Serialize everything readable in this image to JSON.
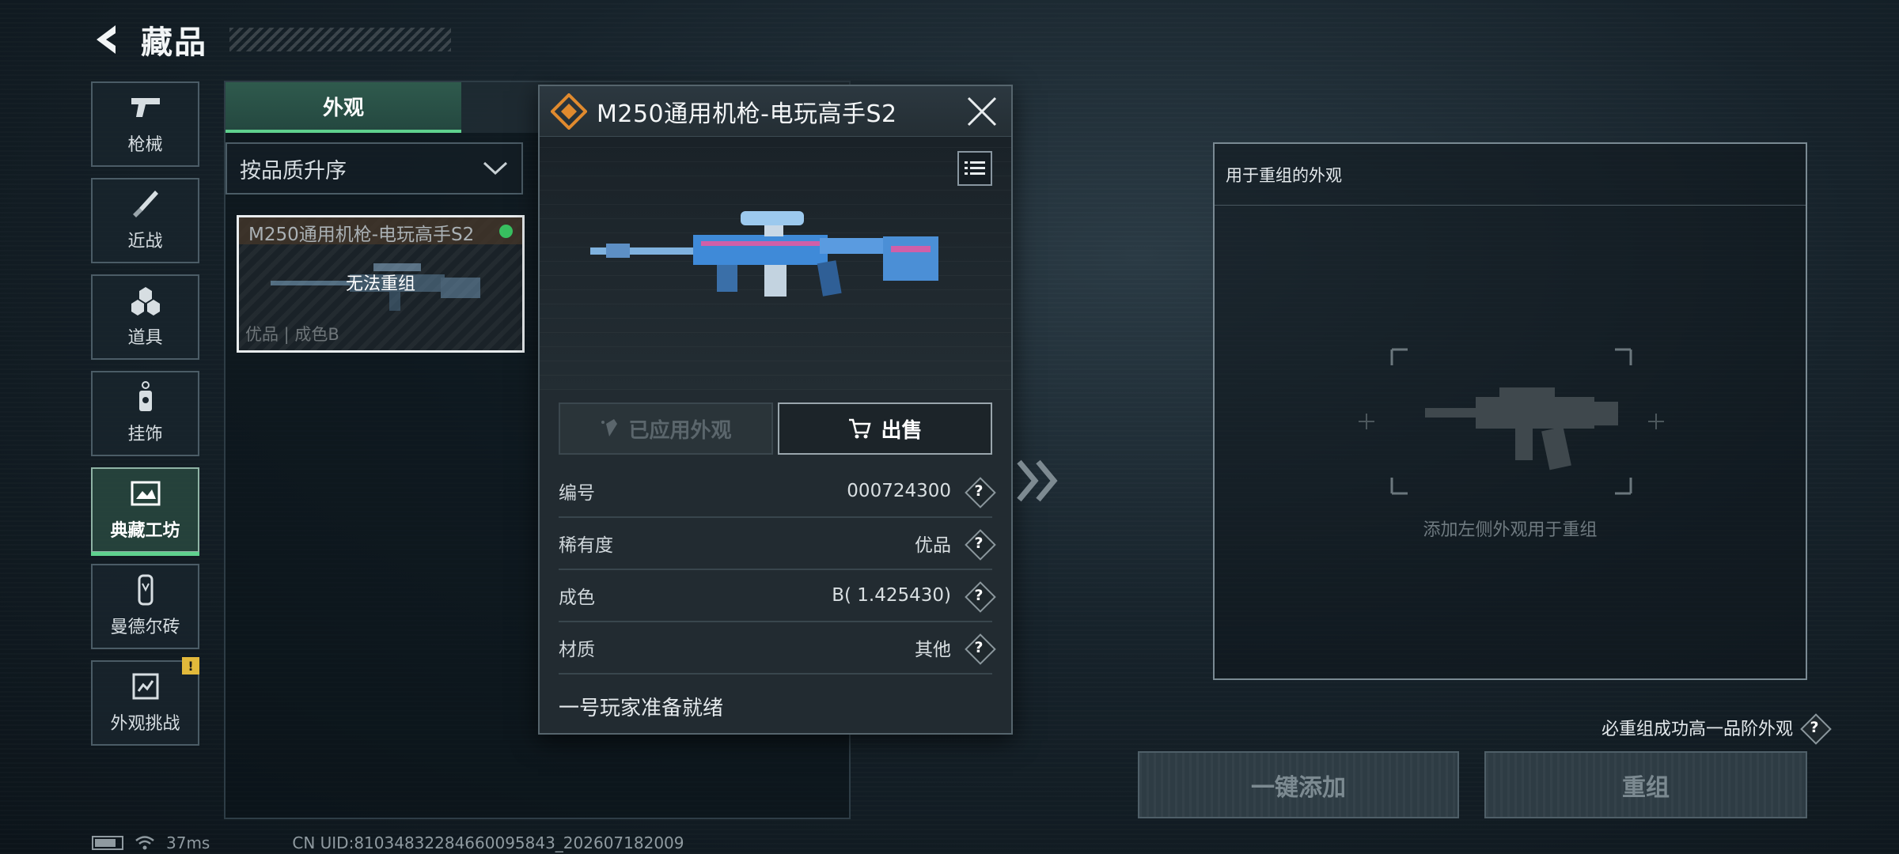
{
  "header": {
    "title": "藏品"
  },
  "sidebar": {
    "items": [
      {
        "label": "枪械",
        "icon": "pistol-icon"
      },
      {
        "label": "近战",
        "icon": "knife-icon"
      },
      {
        "label": "道具",
        "icon": "grenade-cluster-icon"
      },
      {
        "label": "挂饰",
        "icon": "charm-icon"
      },
      {
        "label": "典藏工坊",
        "icon": "workshop-icon",
        "active": true
      },
      {
        "label": "曼德尔砖",
        "icon": "mandel-brick-icon"
      },
      {
        "label": "外观挑战",
        "icon": "challenge-icon",
        "badge": "!"
      }
    ]
  },
  "list_panel": {
    "tab_label": "外观",
    "sort_label": "按品质升序",
    "card": {
      "name": "M250通用机枪-电玩高手S2",
      "overlay": "无法重组",
      "meta": "优品 | 成色B"
    }
  },
  "detail": {
    "title": "M250通用机枪-电玩高手S2",
    "applied_label": "已应用外观",
    "sell_label": "出售",
    "attributes": [
      {
        "key": "编号",
        "value": "000724300"
      },
      {
        "key": "稀有度",
        "value": "优品"
      },
      {
        "key": "成色",
        "value": "B( 1.425430)"
      },
      {
        "key": "材质",
        "value": "其他"
      }
    ],
    "flavor": "一号玩家准备就绪"
  },
  "recombine": {
    "header": "用于重组的外观",
    "hint": "添加左侧外观用于重组",
    "guarantee": "必重组成功高一品阶外观",
    "quick_add_label": "一键添加",
    "recombine_label": "重组"
  },
  "status": {
    "ping": "37ms",
    "uid": "CN UID:81034832284660095843_202607182009"
  },
  "colors": {
    "accent_green": "#5fd18e",
    "rarity_green": "#38c060",
    "warning": "#e2b93b"
  }
}
